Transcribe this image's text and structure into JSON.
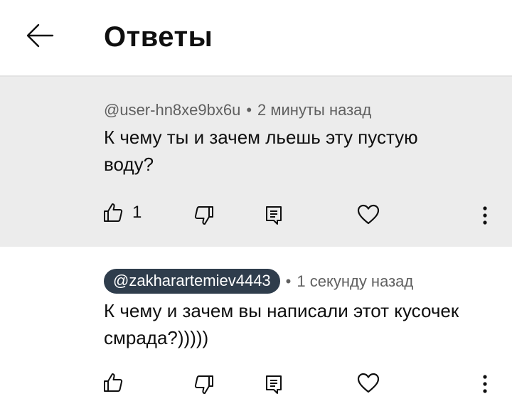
{
  "header": {
    "title": "Ответы"
  },
  "comments": [
    {
      "author": "@user-hn8xe9bx6u",
      "separator": "•",
      "time": "2 минуты назад",
      "text": "К чему ты и зачем льешь эту пустую воду?",
      "like_count": "1",
      "highlighted": true
    },
    {
      "author": "@zakharartemiev4443",
      "separator": "•",
      "time": "1 секунду назад",
      "text": "К чему и зачем вы написали этот кусочек смрада?)))))",
      "highlighted": false
    }
  ],
  "icons": {
    "back": "arrow-left-icon",
    "like": "thumbs-up-icon",
    "dislike": "thumbs-down-icon",
    "reply": "comment-icon",
    "heart": "heart-icon",
    "more": "more-vertical-icon"
  }
}
